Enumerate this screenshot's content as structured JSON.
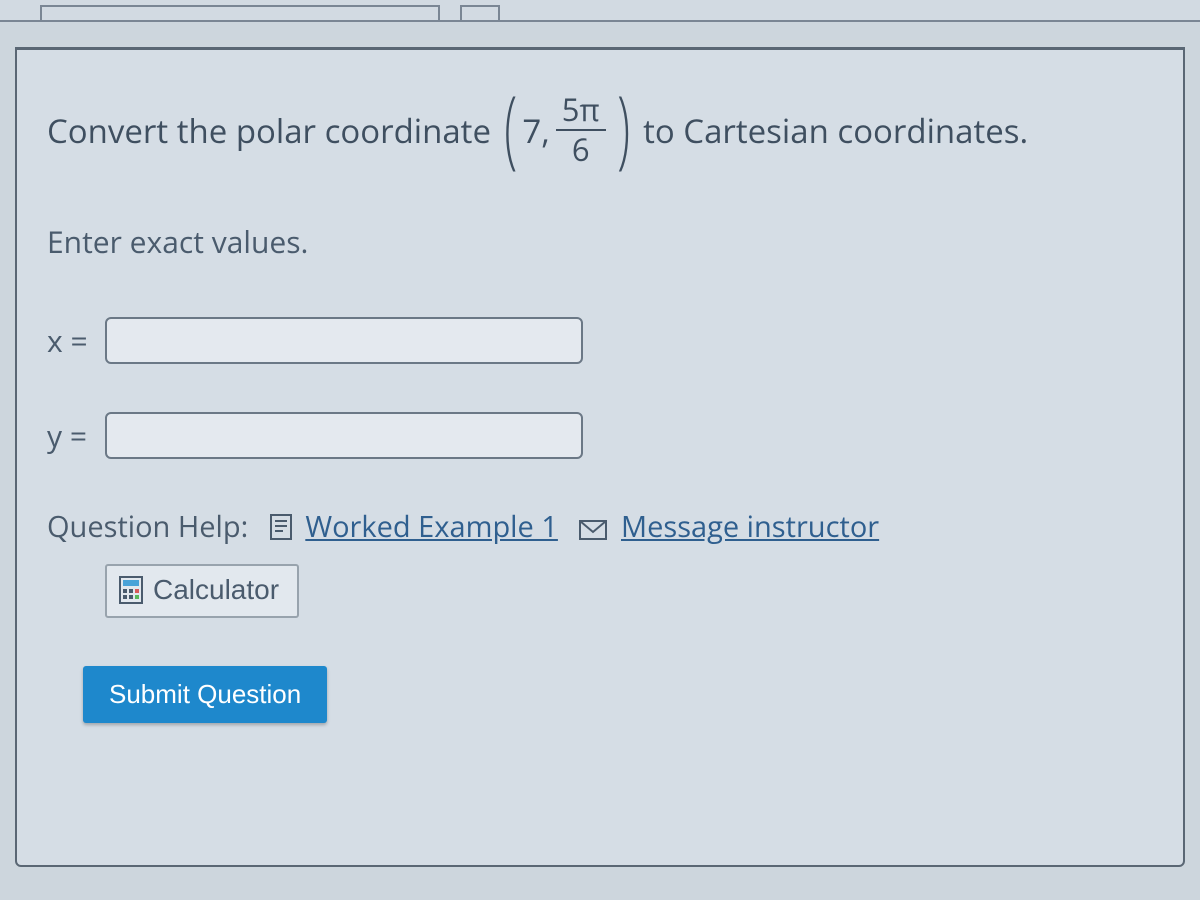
{
  "question": {
    "prefix": "Convert the polar coordinate",
    "r": "7",
    "theta_num": "5π",
    "theta_den": "6",
    "suffix": "to Cartesian coordinates."
  },
  "instruction": "Enter exact values.",
  "inputs": {
    "x_label": "x =",
    "y_label": "y =",
    "x_value": "",
    "y_value": ""
  },
  "help": {
    "label": "Question Help:",
    "worked_example": "Worked Example 1",
    "message_instructor": "Message instructor",
    "calculator": "Calculator"
  },
  "submit": "Submit Question"
}
